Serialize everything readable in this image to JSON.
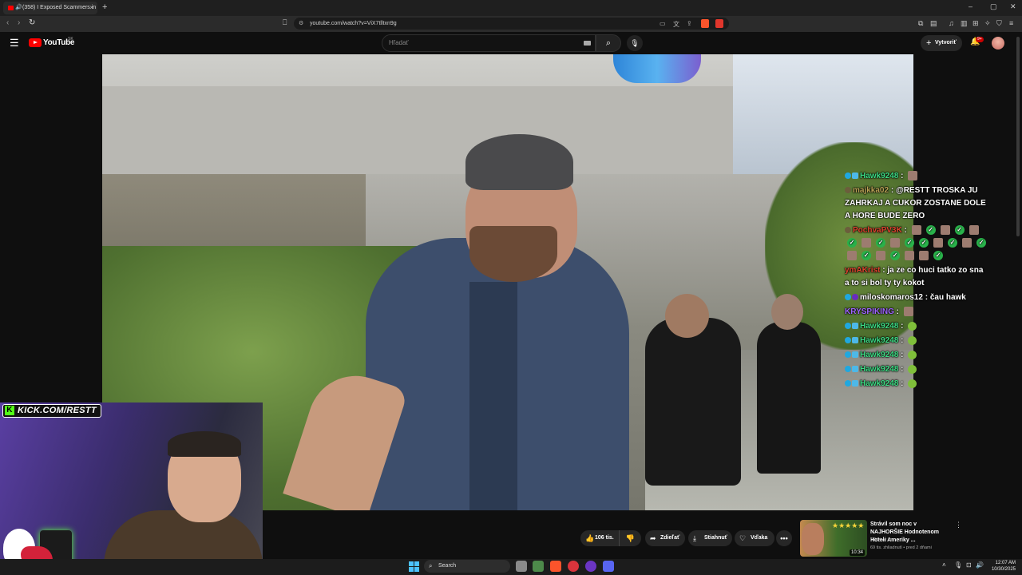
{
  "browser": {
    "tab_title": "(358) I Exposed Scammers in",
    "tab_close": "×",
    "new_tab": "+",
    "url": "youtube.com/watch?v=ViX7tlltxn9g",
    "window_controls": {
      "minimize": "–",
      "maximize": "▢",
      "close": "✕"
    }
  },
  "youtube": {
    "brand": "YouTube",
    "region": "SK",
    "search_placeholder": "Hľadať",
    "create_label": "Vytvoriť",
    "notification_count": "9+"
  },
  "stream_overlay": {
    "kick_banner": "KICK.COM/RESTT",
    "chat": [
      {
        "user": "Hawk9248",
        "user_color": "#3ddc84",
        "message": "",
        "badges": [
          "globe",
          "diamond"
        ],
        "emotes": [
          "face"
        ]
      },
      {
        "user": "majkka02",
        "user_color": "#b8a255",
        "message": "@RESTT TROSKA JU ZAHRKAJ A CUKOR ZOSTANE DOLE A HORE BUDE ZERO",
        "badges": [
          "orb"
        ],
        "emotes": []
      },
      {
        "user": "PochvaPV3K",
        "user_color": "#e0452f",
        "message": "",
        "badges": [
          "orb"
        ],
        "emotes": [
          "face",
          "check",
          "face",
          "check",
          "face",
          "check",
          "face",
          "check",
          "face",
          "check",
          "check",
          "face",
          "check",
          "face",
          "check",
          "face",
          "check",
          "face",
          "check",
          "face",
          "face",
          "check"
        ]
      },
      {
        "user": "ymAKrist",
        "user_color": "#e0452f",
        "message": "ja ze co huci tatko zo sna a to si bol ty ty kokot",
        "badges": [],
        "emotes": []
      },
      {
        "user": "miloskomaros12",
        "user_color": "#ffffff",
        "message": "čau hawk",
        "badges": [
          "globe",
          "purple"
        ],
        "emotes": []
      },
      {
        "user": "KRYSPIKING",
        "user_color": "#a066ff",
        "message": "",
        "badges": [],
        "emotes": [
          "face"
        ]
      },
      {
        "user": "Hawk9248",
        "user_color": "#3ddc84",
        "message": "",
        "badges": [
          "globe",
          "diamond"
        ],
        "emotes": [
          "ball"
        ]
      },
      {
        "user": "Hawk9248",
        "user_color": "#3ddc84",
        "message": "",
        "badges": [
          "globe",
          "diamond"
        ],
        "emotes": [
          "ball"
        ]
      },
      {
        "user": "Hawk9248",
        "user_color": "#3ddc84",
        "message": "",
        "badges": [
          "globe",
          "diamond"
        ],
        "emotes": [
          "ball"
        ]
      },
      {
        "user": "Hawk9248",
        "user_color": "#3ddc84",
        "message": "",
        "badges": [
          "globe",
          "diamond"
        ],
        "emotes": [
          "ball"
        ]
      },
      {
        "user": "Hawk9248",
        "user_color": "#3ddc84",
        "message": "",
        "badges": [
          "globe",
          "diamond"
        ],
        "emotes": [
          "ball"
        ]
      }
    ]
  },
  "actions": {
    "likes": "106 tis.",
    "share": "Zdieľať",
    "download": "Stiahnuť",
    "thanks": "Vďaka",
    "more": "•••"
  },
  "recommendation": {
    "title": "Strávil som noc v NAJHORŠIE Hodnotenom Hoteli Ameriky ...",
    "channel": "PPPiter",
    "meta": "69 tis. zhliadnutí • pred 2 dňami",
    "duration": "10:34",
    "stars": "★★★★★"
  },
  "taskbar": {
    "search_label": "Search",
    "time": "12:07 AM",
    "date": "10/30/2025"
  },
  "colors": {
    "accent_red": "#ff0000",
    "kick_green": "#53fc18",
    "chat_green": "#3ddc84"
  }
}
